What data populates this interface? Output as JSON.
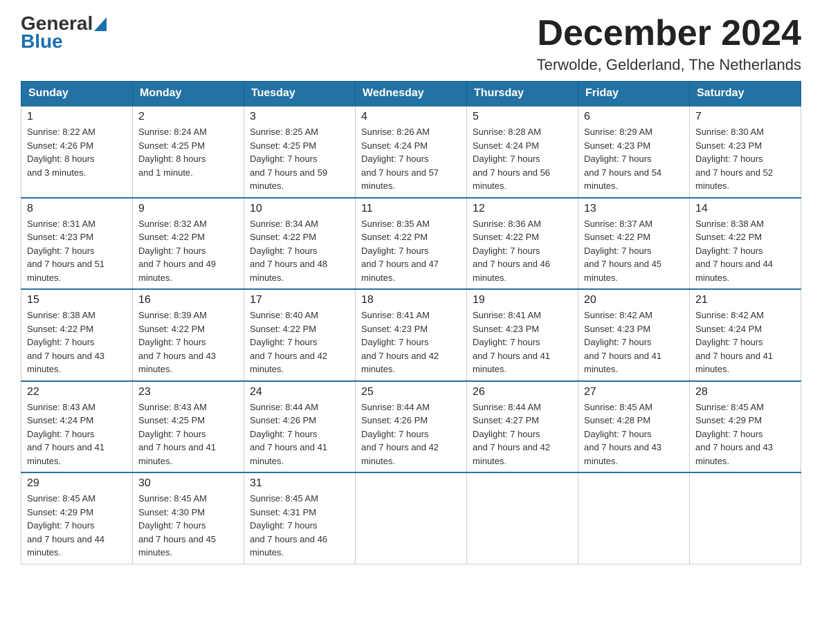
{
  "logo": {
    "general": "General",
    "blue": "Blue"
  },
  "header": {
    "title": "December 2024",
    "subtitle": "Terwolde, Gelderland, The Netherlands"
  },
  "days_of_week": [
    "Sunday",
    "Monday",
    "Tuesday",
    "Wednesday",
    "Thursday",
    "Friday",
    "Saturday"
  ],
  "weeks": [
    [
      {
        "num": "1",
        "sunrise": "8:22 AM",
        "sunset": "4:26 PM",
        "daylight": "8 hours and 3 minutes."
      },
      {
        "num": "2",
        "sunrise": "8:24 AM",
        "sunset": "4:25 PM",
        "daylight": "8 hours and 1 minute."
      },
      {
        "num": "3",
        "sunrise": "8:25 AM",
        "sunset": "4:25 PM",
        "daylight": "7 hours and 59 minutes."
      },
      {
        "num": "4",
        "sunrise": "8:26 AM",
        "sunset": "4:24 PM",
        "daylight": "7 hours and 57 minutes."
      },
      {
        "num": "5",
        "sunrise": "8:28 AM",
        "sunset": "4:24 PM",
        "daylight": "7 hours and 56 minutes."
      },
      {
        "num": "6",
        "sunrise": "8:29 AM",
        "sunset": "4:23 PM",
        "daylight": "7 hours and 54 minutes."
      },
      {
        "num": "7",
        "sunrise": "8:30 AM",
        "sunset": "4:23 PM",
        "daylight": "7 hours and 52 minutes."
      }
    ],
    [
      {
        "num": "8",
        "sunrise": "8:31 AM",
        "sunset": "4:23 PM",
        "daylight": "7 hours and 51 minutes."
      },
      {
        "num": "9",
        "sunrise": "8:32 AM",
        "sunset": "4:22 PM",
        "daylight": "7 hours and 49 minutes."
      },
      {
        "num": "10",
        "sunrise": "8:34 AM",
        "sunset": "4:22 PM",
        "daylight": "7 hours and 48 minutes."
      },
      {
        "num": "11",
        "sunrise": "8:35 AM",
        "sunset": "4:22 PM",
        "daylight": "7 hours and 47 minutes."
      },
      {
        "num": "12",
        "sunrise": "8:36 AM",
        "sunset": "4:22 PM",
        "daylight": "7 hours and 46 minutes."
      },
      {
        "num": "13",
        "sunrise": "8:37 AM",
        "sunset": "4:22 PM",
        "daylight": "7 hours and 45 minutes."
      },
      {
        "num": "14",
        "sunrise": "8:38 AM",
        "sunset": "4:22 PM",
        "daylight": "7 hours and 44 minutes."
      }
    ],
    [
      {
        "num": "15",
        "sunrise": "8:38 AM",
        "sunset": "4:22 PM",
        "daylight": "7 hours and 43 minutes."
      },
      {
        "num": "16",
        "sunrise": "8:39 AM",
        "sunset": "4:22 PM",
        "daylight": "7 hours and 43 minutes."
      },
      {
        "num": "17",
        "sunrise": "8:40 AM",
        "sunset": "4:22 PM",
        "daylight": "7 hours and 42 minutes."
      },
      {
        "num": "18",
        "sunrise": "8:41 AM",
        "sunset": "4:23 PM",
        "daylight": "7 hours and 42 minutes."
      },
      {
        "num": "19",
        "sunrise": "8:41 AM",
        "sunset": "4:23 PM",
        "daylight": "7 hours and 41 minutes."
      },
      {
        "num": "20",
        "sunrise": "8:42 AM",
        "sunset": "4:23 PM",
        "daylight": "7 hours and 41 minutes."
      },
      {
        "num": "21",
        "sunrise": "8:42 AM",
        "sunset": "4:24 PM",
        "daylight": "7 hours and 41 minutes."
      }
    ],
    [
      {
        "num": "22",
        "sunrise": "8:43 AM",
        "sunset": "4:24 PM",
        "daylight": "7 hours and 41 minutes."
      },
      {
        "num": "23",
        "sunrise": "8:43 AM",
        "sunset": "4:25 PM",
        "daylight": "7 hours and 41 minutes."
      },
      {
        "num": "24",
        "sunrise": "8:44 AM",
        "sunset": "4:26 PM",
        "daylight": "7 hours and 41 minutes."
      },
      {
        "num": "25",
        "sunrise": "8:44 AM",
        "sunset": "4:26 PM",
        "daylight": "7 hours and 42 minutes."
      },
      {
        "num": "26",
        "sunrise": "8:44 AM",
        "sunset": "4:27 PM",
        "daylight": "7 hours and 42 minutes."
      },
      {
        "num": "27",
        "sunrise": "8:45 AM",
        "sunset": "4:28 PM",
        "daylight": "7 hours and 43 minutes."
      },
      {
        "num": "28",
        "sunrise": "8:45 AM",
        "sunset": "4:29 PM",
        "daylight": "7 hours and 43 minutes."
      }
    ],
    [
      {
        "num": "29",
        "sunrise": "8:45 AM",
        "sunset": "4:29 PM",
        "daylight": "7 hours and 44 minutes."
      },
      {
        "num": "30",
        "sunrise": "8:45 AM",
        "sunset": "4:30 PM",
        "daylight": "7 hours and 45 minutes."
      },
      {
        "num": "31",
        "sunrise": "8:45 AM",
        "sunset": "4:31 PM",
        "daylight": "7 hours and 46 minutes."
      },
      null,
      null,
      null,
      null
    ]
  ],
  "labels": {
    "sunrise": "Sunrise:",
    "sunset": "Sunset:",
    "daylight": "Daylight:"
  }
}
